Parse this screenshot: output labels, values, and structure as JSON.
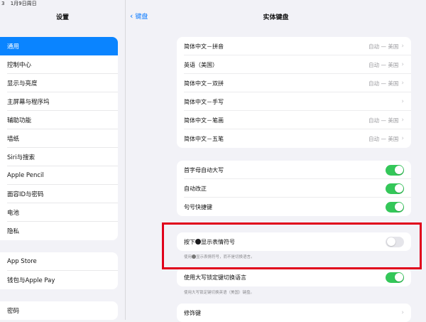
{
  "status_bar": {
    "time": "3",
    "date": "1月9日周日"
  },
  "sidebar": {
    "title": "设置",
    "group1": [
      {
        "label": "通用",
        "selected": true
      },
      {
        "label": "控制中心"
      },
      {
        "label": "显示与亮度"
      },
      {
        "label": "主屏幕与程序坞"
      },
      {
        "label": "辅助功能"
      },
      {
        "label": "墙纸"
      },
      {
        "label": "Siri与搜索"
      },
      {
        "label": "Apple Pencil"
      },
      {
        "label": "面容ID与密码"
      },
      {
        "label": "电池"
      },
      {
        "label": "隐私"
      }
    ],
    "group2": [
      {
        "label": "App Store"
      },
      {
        "label": "钱包与Apple Pay"
      }
    ],
    "group3": [
      {
        "label": "密码"
      }
    ]
  },
  "nav": {
    "back_label": "键盘",
    "title": "实体键盘"
  },
  "keyboards": [
    {
      "label": "简体中文－拼音",
      "value": "自动 — 美国"
    },
    {
      "label": "英语（美国）",
      "value": "自动 — 美国"
    },
    {
      "label": "简体中文－双拼",
      "value": "自动 — 美国"
    },
    {
      "label": "简体中文－手写",
      "value": ""
    },
    {
      "label": "简体中文－笔画",
      "value": "自动 — 美国"
    },
    {
      "label": "简体中文－五笔",
      "value": "自动 — 美国"
    }
  ],
  "toggles1": [
    {
      "label": "首字母自动大写",
      "on": true
    },
    {
      "label": "自动改正",
      "on": true
    },
    {
      "label": "句号快捷键",
      "on": true
    }
  ],
  "emoji_row": {
    "label_before": "按下",
    "label_after": "显示表情符号",
    "on": false,
    "note_before": "使用",
    "note_after": "显示表情符号，而不是切换语言。"
  },
  "capslock_row": {
    "label": "使用大写锁定键切换语言",
    "on": true,
    "note": "使用大写锁定键切换英语（美国）键盘。"
  },
  "modifier_row": {
    "label": "修饰键"
  },
  "colors": {
    "accent": "#0a84ff",
    "toggle_on": "#34c759",
    "highlight_box": "#e0001b"
  }
}
